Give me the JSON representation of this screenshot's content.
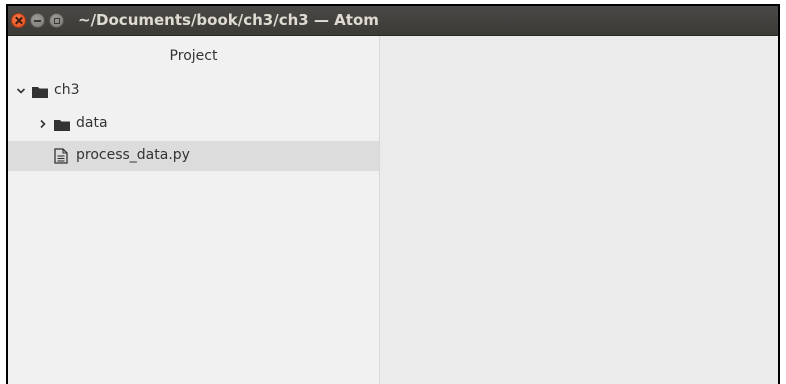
{
  "window": {
    "title": "~/Documents/book/ch3/ch3 — Atom"
  },
  "tree_view": {
    "header": "Project",
    "items": [
      {
        "label": "ch3",
        "type": "folder",
        "expanded": true,
        "depth": 0,
        "selected": false
      },
      {
        "label": "data",
        "type": "folder",
        "expanded": false,
        "depth": 1,
        "selected": false
      },
      {
        "label": "process_data.py",
        "type": "file",
        "depth": 1,
        "selected": true
      }
    ]
  },
  "icons": {
    "expand": "chevron-down-icon",
    "collapse": "chevron-right-icon",
    "folder": "folder-icon",
    "file": "file-text-icon"
  },
  "colors": {
    "titlebar": "#3b3a37",
    "close_button": "#df4b17",
    "selected_row": "#dcdcdc",
    "panel_background": "#f1f1f1"
  }
}
